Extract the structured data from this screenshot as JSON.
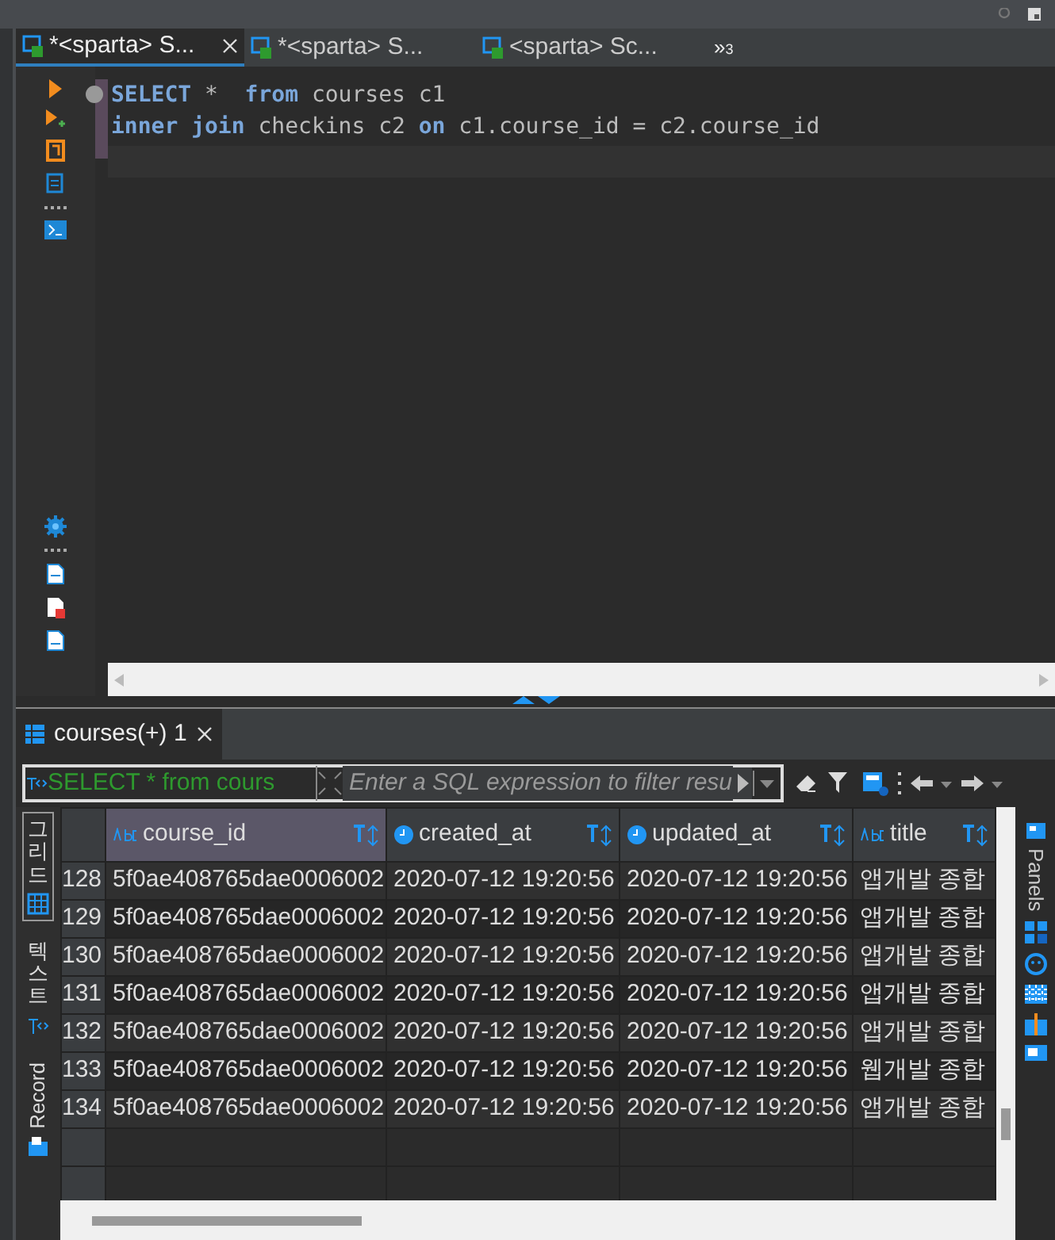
{
  "editor_tabs": [
    {
      "label": "*<sparta> S...",
      "selected": true,
      "closable": true
    },
    {
      "label": "*<sparta> S...",
      "selected": false,
      "closable": false
    },
    {
      "label": "<sparta> Sc...",
      "selected": false,
      "closable": false
    }
  ],
  "tab_overflow": {
    "symbol": "»",
    "count": "3"
  },
  "code_lines": [
    "**SELECT** *  **from** courses c1",
    "**inner join** checkins c2 **on** c1.course_id = c2.course_id"
  ],
  "results_tab": {
    "label": "courses(+) 1"
  },
  "filter": {
    "query": "SELECT * from cours",
    "placeholder": "Enter a SQL expression to filter resu"
  },
  "view_tabs": [
    {
      "label": "그리드",
      "selected": true
    },
    {
      "label": "텍스트",
      "selected": false
    },
    {
      "label": "Record",
      "selected": false
    }
  ],
  "table": {
    "columns": [
      {
        "name": "course_id",
        "kind": "text",
        "selected": true
      },
      {
        "name": "created_at",
        "kind": "time",
        "selected": false
      },
      {
        "name": "updated_at",
        "kind": "time",
        "selected": false
      },
      {
        "name": "title",
        "kind": "text",
        "selected": false
      }
    ],
    "row_numbers": [
      "128",
      "129",
      "130",
      "131",
      "132",
      "133",
      "134"
    ],
    "rows": [
      [
        "5f0ae408765dae0006002",
        "2020-07-12 19:20:56",
        "2020-07-12 19:20:56",
        "앱개발 종합"
      ],
      [
        "5f0ae408765dae0006002",
        "2020-07-12 19:20:56",
        "2020-07-12 19:20:56",
        "앱개발 종합"
      ],
      [
        "5f0ae408765dae0006002",
        "2020-07-12 19:20:56",
        "2020-07-12 19:20:56",
        "앱개발 종합"
      ],
      [
        "5f0ae408765dae0006002",
        "2020-07-12 19:20:56",
        "2020-07-12 19:20:56",
        "앱개발 종합"
      ],
      [
        "5f0ae408765dae0006002",
        "2020-07-12 19:20:56",
        "2020-07-12 19:20:56",
        "앱개발 종합"
      ],
      [
        "5f0ae408765dae0006002",
        "2020-07-12 19:20:56",
        "2020-07-12 19:20:56",
        "웹개발 종합"
      ],
      [
        "5f0ae408765dae0006002",
        "2020-07-12 19:20:56",
        "2020-07-12 19:20:56",
        "앱개발 종합"
      ]
    ]
  },
  "panels_label": "Panels"
}
